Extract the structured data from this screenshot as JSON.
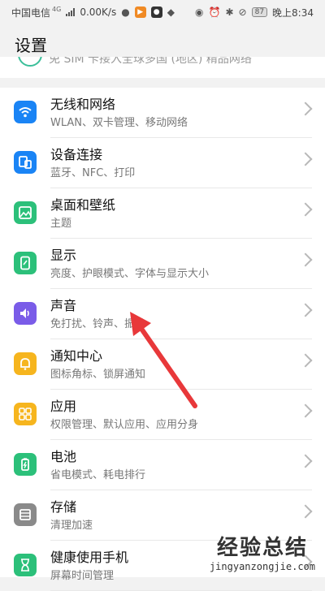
{
  "status_bar": {
    "carrier": "中国电信",
    "network_tag": "4G",
    "speed": "0.00K/s",
    "battery": "87",
    "time": "晚上8:34"
  },
  "header": {
    "title": "设置"
  },
  "partial_row": {
    "text": "免 SIM 卡接入全球多国 (地区) 精品网络"
  },
  "settings": [
    {
      "title": "无线和网络",
      "subtitle": "WLAN、双卡管理、移动网络",
      "icon": "wifi-icon",
      "color": "#1a84f5"
    },
    {
      "title": "设备连接",
      "subtitle": "蓝牙、NFC、打印",
      "icon": "device-connect-icon",
      "color": "#1a84f5"
    },
    {
      "title": "桌面和壁纸",
      "subtitle": "主题",
      "icon": "wallpaper-icon",
      "color": "#2cc07a"
    },
    {
      "title": "显示",
      "subtitle": "亮度、护眼模式、字体与显示大小",
      "icon": "display-icon",
      "color": "#2cc07a"
    },
    {
      "title": "声音",
      "subtitle": "免打扰、铃声、振动",
      "icon": "sound-icon",
      "color": "#7a5ce8"
    },
    {
      "title": "通知中心",
      "subtitle": "图标角标、锁屏通知",
      "icon": "bell-icon",
      "color": "#f6b51e"
    },
    {
      "title": "应用",
      "subtitle": "权限管理、默认应用、应用分身",
      "icon": "apps-icon",
      "color": "#f6b51e"
    },
    {
      "title": "电池",
      "subtitle": "省电模式、耗电排行",
      "icon": "battery-icon",
      "color": "#2cc07a"
    },
    {
      "title": "存储",
      "subtitle": "清理加速",
      "icon": "storage-icon",
      "color": "#8a8a8a"
    },
    {
      "title": "健康使用手机",
      "subtitle": "屏幕时间管理",
      "icon": "hourglass-icon",
      "color": "#2cc07a"
    }
  ],
  "watermark": {
    "main": "经验总结",
    "sub": "jingyanzongjie.com"
  }
}
